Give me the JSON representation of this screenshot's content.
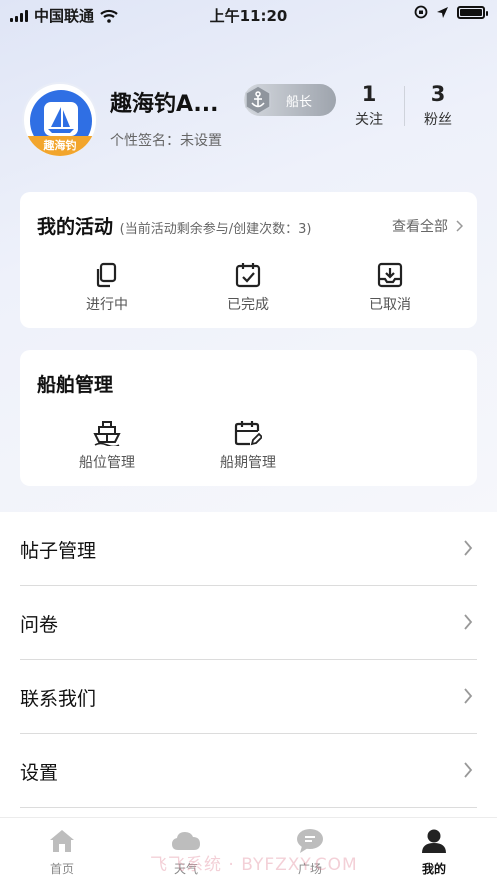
{
  "status_bar": {
    "carrier": "中国联通",
    "time": "上午11:20"
  },
  "profile": {
    "avatar_brand": "趣海钓",
    "nickname": "趣海钓A...",
    "rank_label": "船长",
    "signature": "个性签名：未设置",
    "following_count": "1",
    "following_label": "关注",
    "followers_count": "3",
    "followers_label": "粉丝"
  },
  "activities": {
    "title": "我的活动",
    "note": "(当前活动剩余参与/创建次数：3)",
    "see_all": "查看全部",
    "items": [
      {
        "label": "进行中",
        "icon": "copy-icon"
      },
      {
        "label": "已完成",
        "icon": "calendar-check-icon"
      },
      {
        "label": "已取消",
        "icon": "inbox-download-icon"
      }
    ]
  },
  "ship": {
    "title": "船舶管理",
    "items": [
      {
        "label": "船位管理",
        "icon": "ship-icon"
      },
      {
        "label": "船期管理",
        "icon": "calendar-edit-icon"
      }
    ]
  },
  "menu": [
    {
      "label": "帖子管理"
    },
    {
      "label": "问卷"
    },
    {
      "label": "联系我们"
    },
    {
      "label": "设置"
    }
  ],
  "tabs": [
    {
      "label": "首页",
      "icon": "home-icon",
      "active": false
    },
    {
      "label": "天气",
      "icon": "cloud-icon",
      "active": false
    },
    {
      "label": "广场",
      "icon": "chat-bubble-icon",
      "active": false
    },
    {
      "label": "我的",
      "icon": "user-icon",
      "active": true
    }
  ],
  "watermark": "飞飞系统 · BYFZXY.COM"
}
